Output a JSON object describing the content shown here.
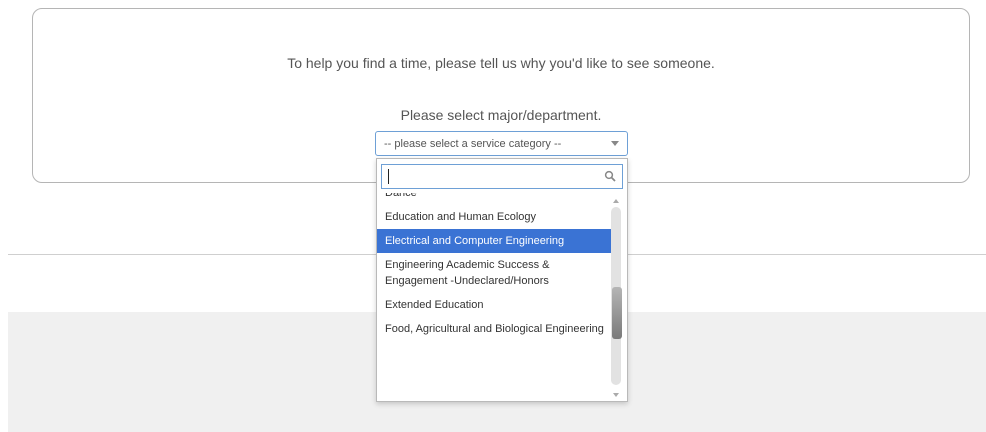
{
  "panel": {
    "prompt": "To help you find a time, please tell us why you'd like to see someone.",
    "subprompt": "Please select major/department.",
    "select_value": "-- please select a service category --"
  },
  "dropdown": {
    "search_value": "",
    "items": [
      "Dance",
      "Education and Human Ecology",
      "Electrical and Computer Engineering",
      "Engineering Academic Success & Engagement -Undeclared/Honors",
      "Extended Education",
      "Food, Agricultural and Biological Engineering"
    ],
    "selected_item": "Electrical and Computer Engineering"
  },
  "colors": {
    "selected_bg": "#3a73d4",
    "focus_border": "#6ea0d6"
  },
  "icons": {
    "search": "search-icon",
    "select_arrow": "chevron-down-icon"
  }
}
